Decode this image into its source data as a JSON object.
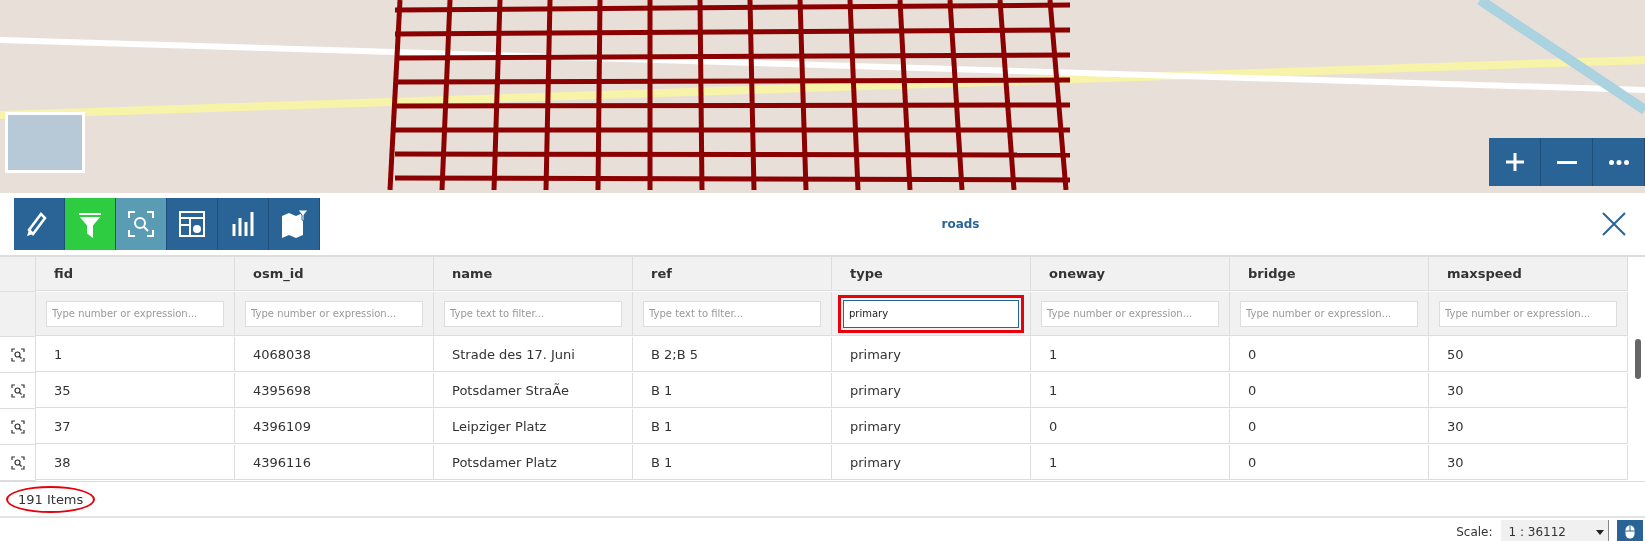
{
  "map": {
    "zoom_controls": [
      {
        "kind": "plus"
      },
      {
        "kind": "minus"
      },
      {
        "kind": "more"
      }
    ]
  },
  "toolbar": {
    "buttons": [
      {
        "kind": "edit",
        "active": false,
        "hover": false
      },
      {
        "kind": "filter",
        "active": true,
        "hover": false
      },
      {
        "kind": "zoom",
        "active": false,
        "hover": true
      },
      {
        "kind": "table-settings",
        "active": false,
        "hover": false
      },
      {
        "kind": "chart",
        "active": false,
        "hover": false
      },
      {
        "kind": "map-filter",
        "active": false,
        "hover": false
      }
    ],
    "title": "roads"
  },
  "table": {
    "columns": [
      {
        "label": "fid",
        "filter": {
          "placeholder": "Type number or expression...",
          "highlighted": false
        }
      },
      {
        "label": "osm_id",
        "filter": {
          "placeholder": "Type number or expression...",
          "highlighted": false
        }
      },
      {
        "label": "name",
        "filter": {
          "placeholder": "Type text to filter...",
          "highlighted": false
        }
      },
      {
        "label": "ref",
        "filter": {
          "placeholder": "Type text to filter...",
          "highlighted": false
        }
      },
      {
        "label": "type",
        "filter": {
          "value": "primary",
          "highlighted": true
        }
      },
      {
        "label": "oneway",
        "filter": {
          "placeholder": "Type number or expression...",
          "highlighted": false
        }
      },
      {
        "label": "bridge",
        "filter": {
          "placeholder": "Type number or expression...",
          "highlighted": false
        }
      },
      {
        "label": "maxspeed",
        "filter": {
          "placeholder": "Type number or expression...",
          "highlighted": false
        }
      }
    ],
    "rows": [
      [
        "1",
        "4068038",
        "Strade des 17. Juni",
        "B 2;B 5",
        "primary",
        "1",
        "0",
        "50"
      ],
      [
        "35",
        "4395698",
        "Potsdamer StraÃe",
        "B 1",
        "primary",
        "1",
        "0",
        "30"
      ],
      [
        "37",
        "4396109",
        "Leipziger Platz",
        "B 1",
        "primary",
        "0",
        "0",
        "30"
      ],
      [
        "38",
        "4396116",
        "Potsdamer Platz",
        "B 1",
        "primary",
        "1",
        "0",
        "30"
      ]
    ],
    "item_count": {
      "text": "191 Items",
      "highlighted": true
    }
  },
  "status_bar": {
    "scale_label": "Scale:",
    "scale_value": "1 : 36112"
  }
}
